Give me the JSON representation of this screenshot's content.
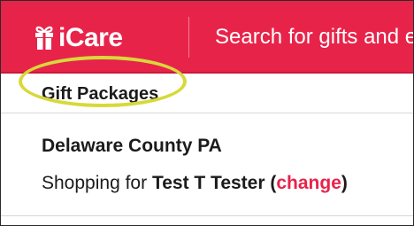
{
  "brand": {
    "name": "iCare",
    "accent_color": "#e8234a",
    "logo_icon": "gift-icon"
  },
  "search": {
    "placeholder": "Search for gifts and e"
  },
  "nav": {
    "current": "Gift Packages"
  },
  "location": {
    "name": "Delaware County PA"
  },
  "shopper": {
    "prefix": "Shopping for",
    "name": "Test T Tester",
    "open_paren": "(",
    "change_label": "change",
    "close_paren": ")"
  }
}
